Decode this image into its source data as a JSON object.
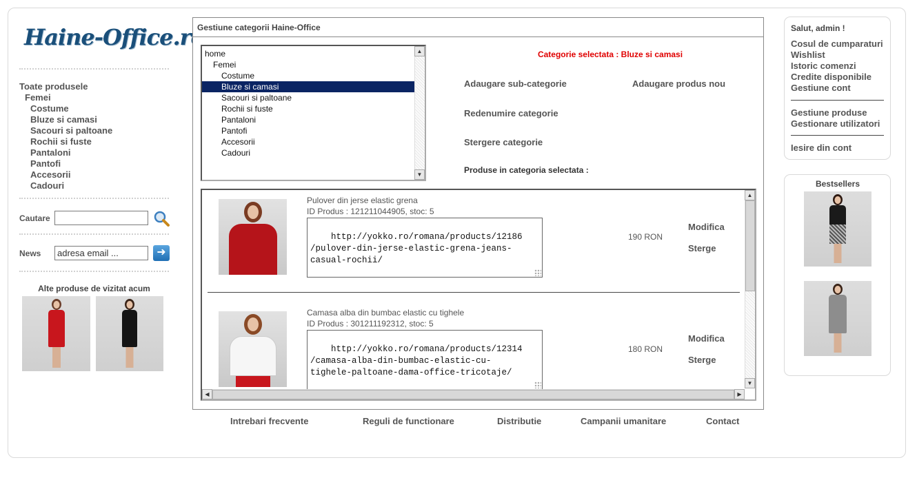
{
  "logo": {
    "text": "Haine-Office.ro"
  },
  "left_nav": {
    "items": [
      {
        "label": "Toate produsele"
      },
      {
        "label": "Femei"
      },
      {
        "label": "Costume"
      },
      {
        "label": "Bluze si camasi"
      },
      {
        "label": "Sacouri si paltoane"
      },
      {
        "label": "Rochii si fuste"
      },
      {
        "label": "Pantaloni"
      },
      {
        "label": "Pantofi"
      },
      {
        "label": "Accesorii"
      },
      {
        "label": "Cadouri"
      }
    ]
  },
  "search": {
    "label": "Cautare",
    "value": ""
  },
  "news": {
    "label": "News",
    "value": "adresa email ..."
  },
  "other_products": {
    "title": "Alte produse de vizitat acum"
  },
  "panel": {
    "title": "Gestiune categorii Haine-Office",
    "tree": [
      {
        "label": "home"
      },
      {
        "label": "Femei"
      },
      {
        "label": "Costume"
      },
      {
        "label": "Bluze si camasi"
      },
      {
        "label": "Sacouri si paltoane"
      },
      {
        "label": "Rochii si fuste"
      },
      {
        "label": "Pantaloni"
      },
      {
        "label": "Pantofi"
      },
      {
        "label": "Accesorii"
      },
      {
        "label": "Cadouri"
      }
    ],
    "selected_category": "Categorie selectata : Bluze si camasi",
    "actions": {
      "add_subcategory": "Adaugare sub-categorie",
      "add_product": "Adaugare produs nou",
      "rename": "Redenumire categorie",
      "delete": "Stergere categorie"
    },
    "products_label": "Produse in categoria selectata :",
    "products": [
      {
        "name": "Pulover din jerse elastic grena",
        "id_line": "ID Produs : 121211044905, stoc: 5",
        "url": "http://yokko.ro/romana/products/12186\n/pulover-din-jerse-elastic-grena-jeans-\ncasual-rochii/",
        "price": "190 RON",
        "edit": "Modifica",
        "delete": "Sterge"
      },
      {
        "name": "Camasa alba din bumbac elastic cu tighele",
        "id_line": "ID Produs : 301211192312, stoc: 5",
        "url": "http://yokko.ro/romana/products/12314\n/camasa-alba-din-bumbac-elastic-cu-\ntighele-paltoane-dama-office-tricotaje/",
        "price": "180 RON",
        "edit": "Modifica",
        "delete": "Sterge"
      }
    ]
  },
  "footer": {
    "links": [
      {
        "label": "Intrebari frecvente"
      },
      {
        "label": "Reguli de functionare"
      },
      {
        "label": "Distributie"
      },
      {
        "label": "Campanii umanitare"
      },
      {
        "label": "Contact"
      }
    ]
  },
  "user_menu": {
    "greeting": "Salut, admin !",
    "links": [
      {
        "label": "Cosul de cumparaturi"
      },
      {
        "label": "Wishlist"
      },
      {
        "label": "Istoric comenzi"
      },
      {
        "label": "Credite disponibile"
      },
      {
        "label": "Gestiune cont"
      }
    ],
    "admin_links": [
      {
        "label": "Gestiune produse"
      },
      {
        "label": "Gestionare utilizatori"
      }
    ],
    "logout": "Iesire din cont"
  },
  "bestsellers": {
    "title": "Bestsellers"
  },
  "colors": {
    "selection": "#0a2463",
    "selected_category_text": "#e00000",
    "logo": "#1a4f7a"
  }
}
